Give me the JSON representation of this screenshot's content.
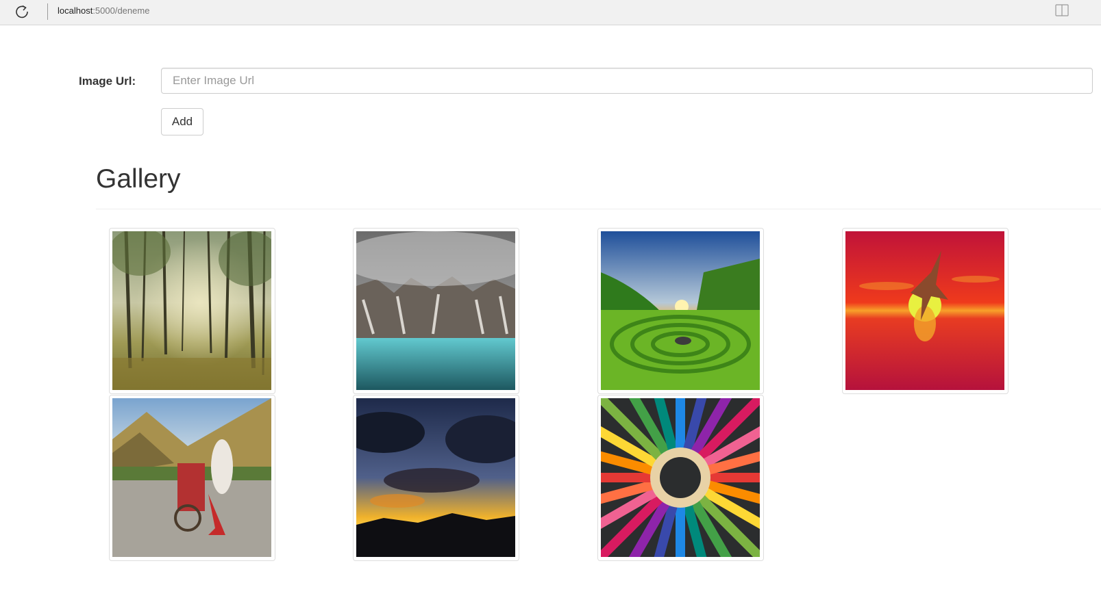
{
  "browser": {
    "url_host": "localhost",
    "url_path": ":5000/deneme",
    "reload_icon": "reload-icon",
    "reader_icon": "reader-view-icon"
  },
  "form": {
    "label": "Image Url:",
    "placeholder": "Enter Image Url",
    "value": "",
    "add_label": "Add"
  },
  "gallery": {
    "title": "Gallery",
    "images": [
      {
        "subject": "sunlit forest"
      },
      {
        "subject": "cliffs above turquoise lake"
      },
      {
        "subject": "green spiral valley at sunset"
      },
      {
        "subject": "bird flying over red sunset sea"
      },
      {
        "subject": "horse carriage on mountain road"
      },
      {
        "subject": "dramatic sunset clouds"
      },
      {
        "subject": "circle of colored pencils"
      }
    ]
  }
}
